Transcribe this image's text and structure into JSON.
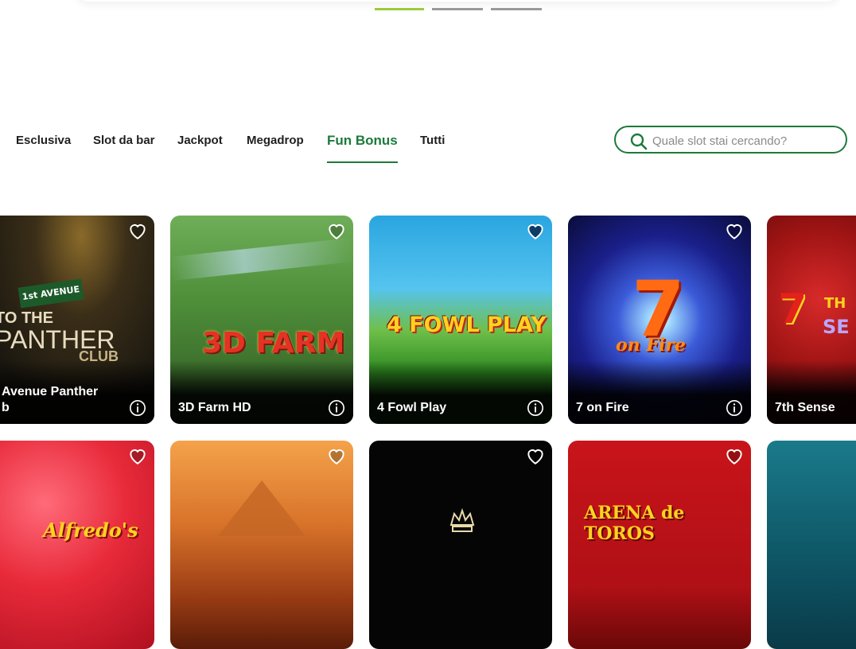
{
  "carousel": {
    "indicators": [
      true,
      false,
      false
    ]
  },
  "tabs": [
    {
      "label": "Esclusiva",
      "active": false
    },
    {
      "label": "Slot da bar",
      "active": false
    },
    {
      "label": "Jackpot",
      "active": false
    },
    {
      "label": "Megadrop",
      "active": false
    },
    {
      "label": "Fun Bonus",
      "active": true
    },
    {
      "label": "Tutti",
      "active": false
    }
  ],
  "search": {
    "placeholder": "Quale slot stai cercando?",
    "value": ""
  },
  "games_row1": [
    {
      "title": "Avenue Panther\nb",
      "logo_lines": [
        "1st AVENUE",
        "TO THE",
        "PANTHER",
        "CLUB"
      ]
    },
    {
      "title": "3D Farm HD",
      "logo_lines": [
        "3D FARM"
      ]
    },
    {
      "title": "4 Fowl Play",
      "logo_lines": [
        "4 FOWL PLAY"
      ]
    },
    {
      "title": "7 on Fire",
      "logo_lines": [
        "7",
        "on Fire"
      ]
    },
    {
      "title": "7th Sense",
      "logo_lines": [
        "7",
        "TH",
        "SE"
      ]
    }
  ],
  "games_row2": [
    {
      "logo_lines": [
        "Alfredo's"
      ]
    },
    {
      "logo_lines": [
        ""
      ]
    },
    {
      "logo_lines": [
        ""
      ]
    },
    {
      "logo_lines": [
        "ARENA de TOROS"
      ]
    },
    {
      "logo_lines": [
        ""
      ]
    }
  ],
  "colors": {
    "accent": "#1c7a3a",
    "indicator_active": "#9bcb3c",
    "indicator_inactive": "#9a9a9a"
  },
  "icons": {
    "favorite": "heart-icon",
    "info": "info-icon",
    "search": "search-icon"
  }
}
